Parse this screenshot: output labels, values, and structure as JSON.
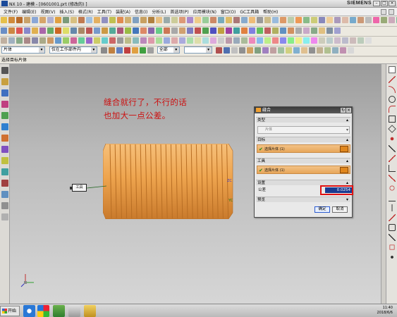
{
  "window": {
    "title": "NX 10 - 建模 - [0601001.prt (修改的) ]",
    "brand": "SIEMENS"
  },
  "menu": [
    "文件(F)",
    "编辑(E)",
    "视图(V)",
    "插入(S)",
    "格式(R)",
    "工具(T)",
    "装配(A)",
    "信息(I)",
    "分析(L)",
    "首选项(P)",
    "应用模块(N)",
    "窗口(O)",
    "GC工具箱",
    "帮助(H)"
  ],
  "toolbar_filters": {
    "type_filter": "片体",
    "assembly_scope": "仅在工作部件内",
    "snap": "全部"
  },
  "status_prompt": "选择目标片体",
  "annotation": {
    "line1": "缝合就行了，不行的话",
    "line2": "也加大一点公差。"
  },
  "callout_label": "工具",
  "axes": {
    "zc": "ZC",
    "yc": "YC"
  },
  "dialog": {
    "title": "缝合",
    "section_type": "类型",
    "type_value": "片体",
    "section_target": "目标",
    "target_select": "选择片体 (1)",
    "section_tool": "工具",
    "tool_select": "选择片体 (1)",
    "section_settings": "设置",
    "tolerance_label": "公差",
    "tolerance_value": "0.0254",
    "section_preview": "预览",
    "ok_label": "确定",
    "cancel_label": "取消"
  },
  "taskbar": {
    "start_label": "开始",
    "time": "11:40",
    "date": "2018/6/6"
  },
  "colors": {
    "accent_orange": "#e8a050",
    "highlight_red": "#e01010",
    "selection_blue": "#1a3a8f"
  }
}
